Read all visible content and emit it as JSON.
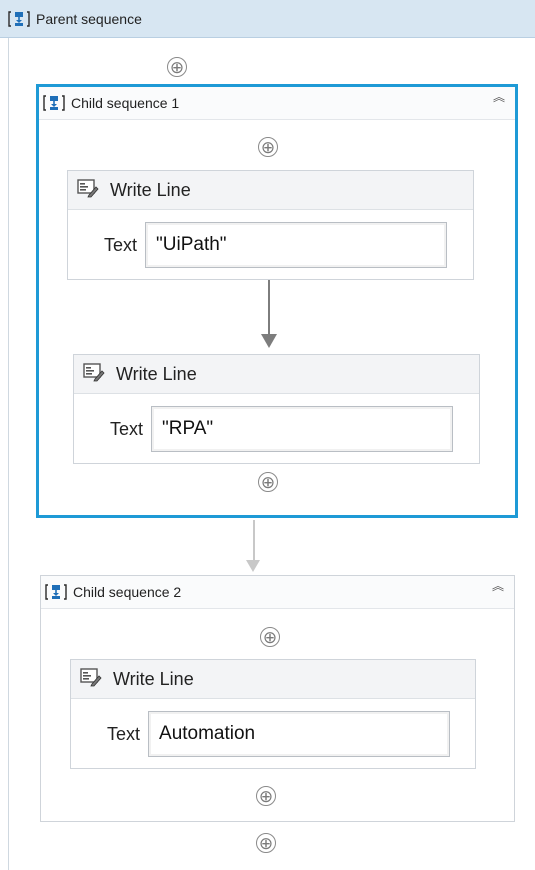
{
  "parent": {
    "title": "Parent sequence"
  },
  "child1": {
    "title": "Child sequence 1",
    "activities": [
      {
        "title": "Write Line",
        "field_label": "Text",
        "value": "\"UiPath\""
      },
      {
        "title": "Write Line",
        "field_label": "Text",
        "value": "\"RPA\""
      }
    ]
  },
  "child2": {
    "title": "Child sequence 2",
    "activities": [
      {
        "title": "Write Line",
        "field_label": "Text",
        "value": "Automation"
      }
    ]
  },
  "icons": {
    "add": "⊕",
    "collapse": "︽"
  },
  "colors": {
    "selected_border": "#1e9ad6",
    "header_bg": "#d7e6f2",
    "icon_blue": "#1f6fb8"
  }
}
